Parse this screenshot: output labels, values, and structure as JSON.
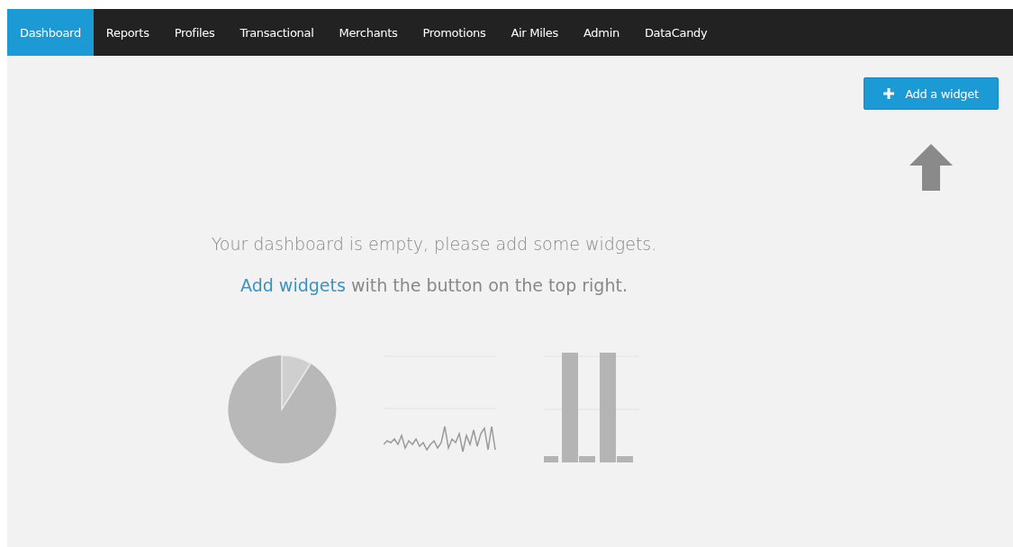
{
  "nav": {
    "tabs": [
      {
        "label": "Dashboard",
        "selected": true
      },
      {
        "label": "Reports",
        "selected": false
      },
      {
        "label": "Profiles",
        "selected": false
      },
      {
        "label": "Transactional",
        "selected": false
      },
      {
        "label": "Merchants",
        "selected": false
      },
      {
        "label": "Promotions",
        "selected": false
      },
      {
        "label": "Air Miles",
        "selected": false
      },
      {
        "label": "Admin",
        "selected": false
      },
      {
        "label": "DataCandy",
        "selected": false
      }
    ]
  },
  "add_widget_button": {
    "label": "Add a widget"
  },
  "empty_state": {
    "message": "Your dashboard is empty, please add some widgets.",
    "link": "Add widgets",
    "hint": " with the button on the top right."
  }
}
